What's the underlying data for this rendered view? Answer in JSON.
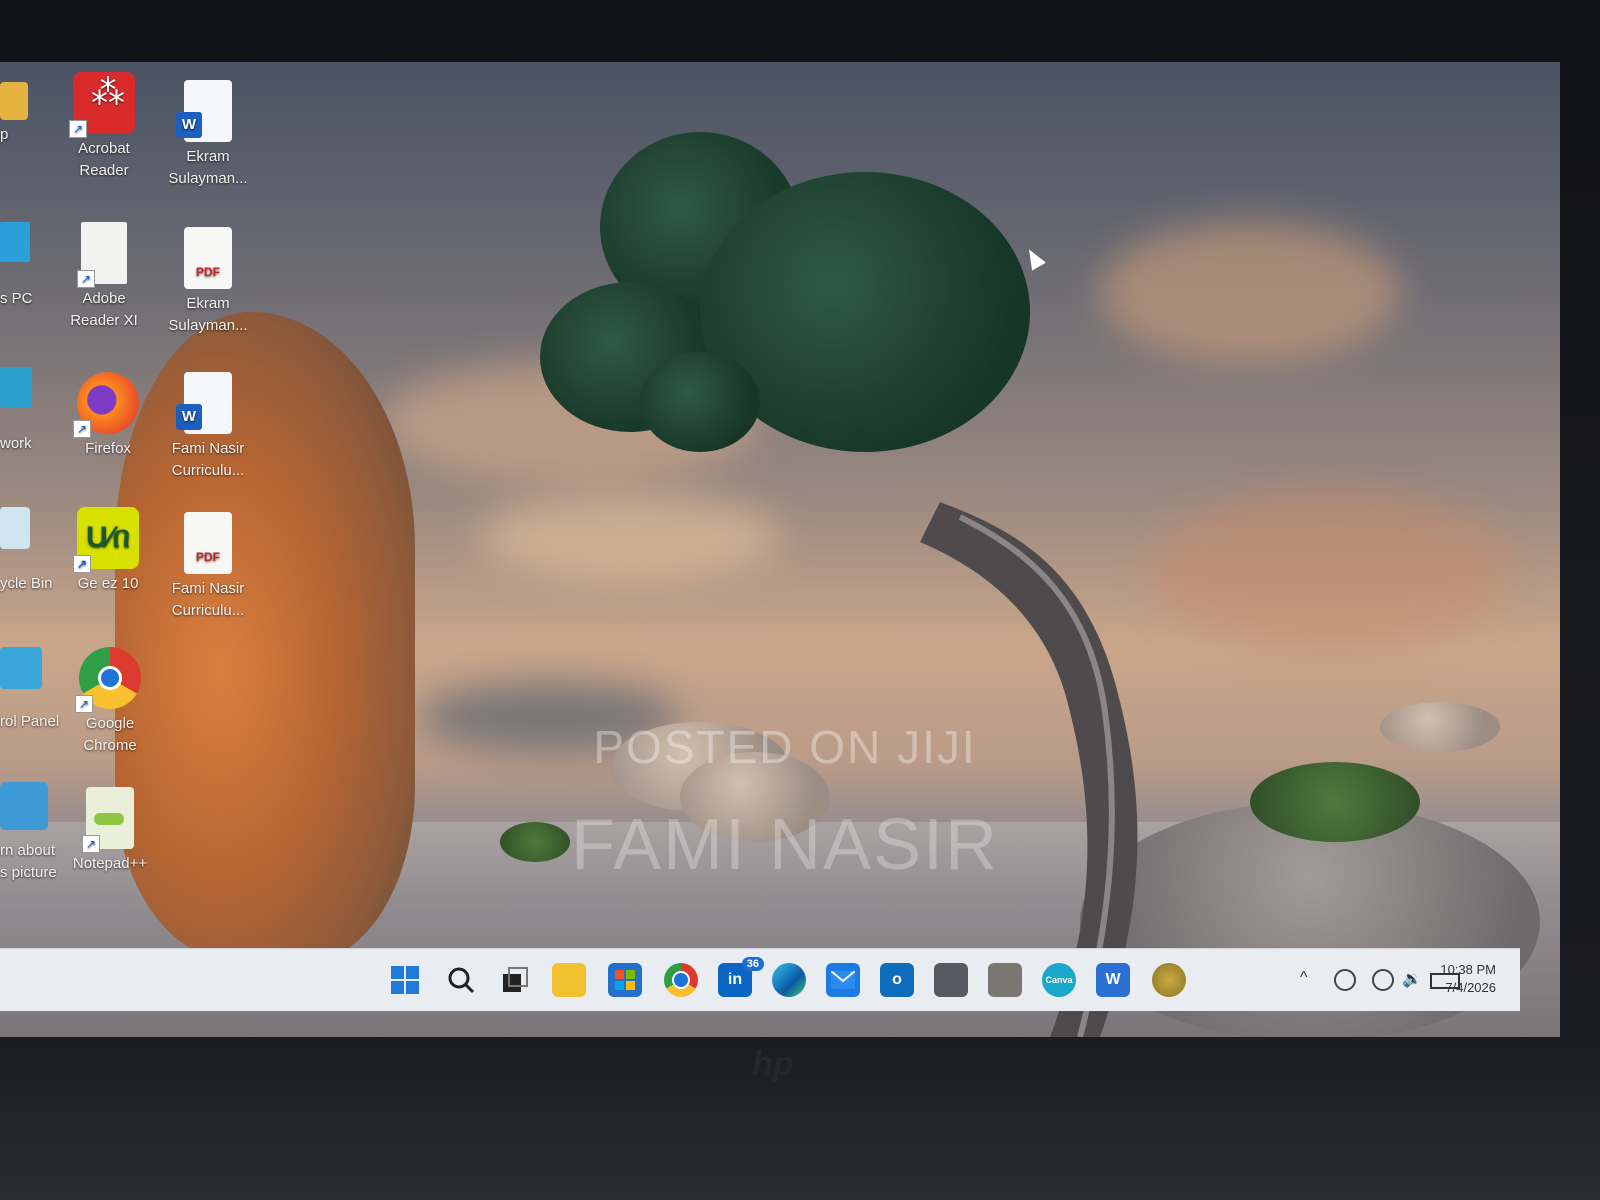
{
  "desktop": {
    "icons": [
      {
        "name": "acrobat-reader",
        "label_lines": [
          "Acrobat",
          "Reader"
        ],
        "icon": "acrobat-icon"
      },
      {
        "name": "ekram-word-doc",
        "label_lines": [
          "Ekram",
          "Sulayman..."
        ],
        "icon": "word-doc-icon"
      },
      {
        "name": "adobe-reader-xi",
        "label_lines": [
          "Adobe",
          "Reader XI"
        ],
        "icon": "blank-doc-icon"
      },
      {
        "name": "ekram-pdf",
        "label_lines": [
          "Ekram",
          "Sulayman..."
        ],
        "icon": "pdf-icon"
      },
      {
        "name": "firefox",
        "label_lines": [
          "Firefox"
        ],
        "icon": "firefox-icon"
      },
      {
        "name": "fami-word-doc",
        "label_lines": [
          "Fami Nasir",
          "Curriculu..."
        ],
        "icon": "word-doc-icon"
      },
      {
        "name": "geez-10",
        "label_lines": [
          "Ge ez 10"
        ],
        "icon": "geez-icon"
      },
      {
        "name": "fami-pdf",
        "label_lines": [
          "Fami Nasir",
          "Curriculu..."
        ],
        "icon": "pdf-icon"
      },
      {
        "name": "google-chrome",
        "label_lines": [
          "Google",
          "Chrome"
        ],
        "icon": "chrome-icon"
      },
      {
        "name": "notepad-plus",
        "label_lines": [
          "Notepad++"
        ],
        "icon": "notepad-icon"
      }
    ],
    "partial_icons": [
      {
        "name": "partial-user",
        "label_lines": [
          "p"
        ]
      },
      {
        "name": "partial-this-pc",
        "label_lines": [
          "s PC"
        ]
      },
      {
        "name": "partial-network",
        "label_lines": [
          "work"
        ]
      },
      {
        "name": "partial-recycle-bin",
        "label_lines": [
          "ycle Bin"
        ]
      },
      {
        "name": "partial-control-panel",
        "label_lines": [
          "rol Panel"
        ]
      },
      {
        "name": "partial-learn-picture",
        "label_lines": [
          "rn about",
          "s picture"
        ]
      }
    ]
  },
  "watermark": {
    "line1": "POSTED ON JIJI",
    "line2": "FAMI NASIR"
  },
  "taskbar": {
    "linkedin_badge": "36",
    "apps": [
      "start-icon",
      "search-icon",
      "task-view-icon",
      "file-explorer-icon",
      "store-icon",
      "chrome-icon",
      "linkedin-icon",
      "edge-icon",
      "mail-icon",
      "outlook-icon",
      "app-icon",
      "photo-app-icon",
      "canva-icon",
      "word-icon",
      "coin-app-icon"
    ],
    "canva_label": "Canva",
    "word_label": "W",
    "linkedin_label": "in"
  },
  "tray": {
    "time": "10:38 PM",
    "date": "7/4/2026",
    "chevron": "^"
  },
  "bezel": {
    "brand": "hp"
  },
  "colors": {
    "taskbar_bg": "#e9ecf1",
    "accent": "#1b6fd1"
  }
}
